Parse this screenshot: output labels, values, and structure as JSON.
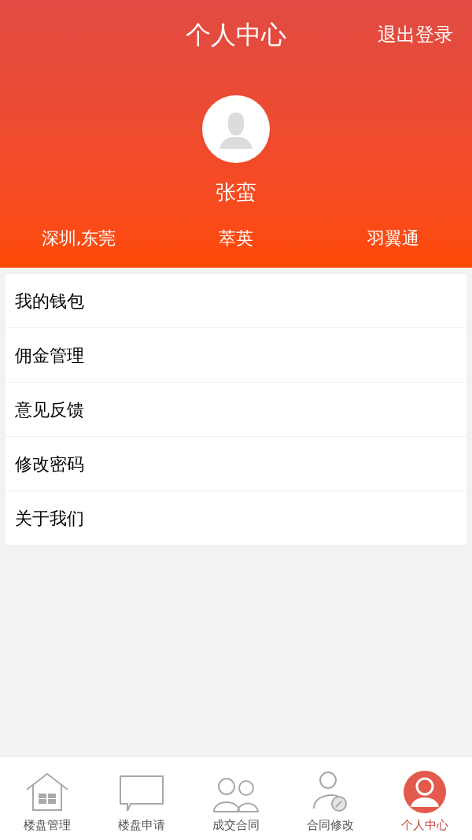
{
  "header": {
    "title": "个人中心",
    "logout": "退出登录",
    "user_name": "张蛮",
    "info": [
      "深圳,东莞",
      "萃英",
      "羽翼通"
    ]
  },
  "menu": [
    {
      "label": "我的钱包"
    },
    {
      "label": "佣金管理"
    },
    {
      "label": "意见反馈"
    },
    {
      "label": "修改密码"
    },
    {
      "label": "关于我们"
    }
  ],
  "tabs": [
    {
      "label": "楼盘管理",
      "selected": false
    },
    {
      "label": "楼盘申请",
      "selected": false
    },
    {
      "label": "成交合同",
      "selected": false
    },
    {
      "label": "合同修改",
      "selected": false
    },
    {
      "label": "个人中心",
      "selected": true
    }
  ]
}
